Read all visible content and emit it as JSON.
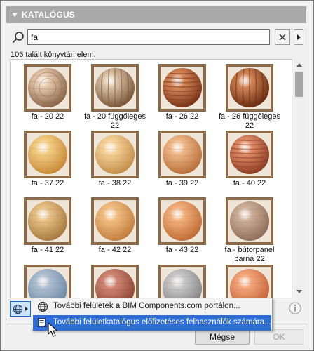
{
  "catalog": {
    "header": "KATALÓGUS",
    "search_value": "fa",
    "result_count": "106 talált könyvtári elem:"
  },
  "items": [
    {
      "label": "fa - 20 22",
      "colors": [
        "#e6c9ad",
        "#8a6448"
      ],
      "style": "ring"
    },
    {
      "label": "fa - 20 függőleges 22",
      "colors": [
        "#dcc4a8",
        "#7a5638"
      ],
      "style": "vertical"
    },
    {
      "label": "fa - 26 22",
      "colors": [
        "#d78a5a",
        "#7a3318"
      ],
      "style": "bands"
    },
    {
      "label": "fa - 26 függőleges 22",
      "colors": [
        "#d08554",
        "#6a2c12"
      ],
      "style": "vertical"
    },
    {
      "label": "fa - 37 22",
      "colors": [
        "#f4cf86",
        "#c98a38"
      ],
      "style": "plain"
    },
    {
      "label": "fa - 38 22",
      "colors": [
        "#f6d299",
        "#c48e4a"
      ],
      "style": "plain"
    },
    {
      "label": "fa - 39 22",
      "colors": [
        "#f0b98a",
        "#b8703a"
      ],
      "style": "plain"
    },
    {
      "label": "fa - 40 22",
      "colors": [
        "#e2906a",
        "#8e3f24"
      ],
      "style": "bands"
    },
    {
      "label": "fa - 41 22",
      "colors": [
        "#e8c287",
        "#a67a3e"
      ],
      "style": "plain"
    },
    {
      "label": "fa - 42 22",
      "colors": [
        "#f2be82",
        "#c27e3e"
      ],
      "style": "plain"
    },
    {
      "label": "fa - 43 22",
      "colors": [
        "#f2b07c",
        "#bf6d34"
      ],
      "style": "plain"
    },
    {
      "label": "fa - bútorpanel barna 22",
      "colors": [
        "#cdb09a",
        "#8f6e58"
      ],
      "style": "plain"
    },
    {
      "label": "",
      "colors": [
        "#aebfd0",
        "#6e8aa5"
      ],
      "style": "plain"
    },
    {
      "label": "",
      "colors": [
        "#d08573",
        "#8d4635"
      ],
      "style": "plain"
    },
    {
      "label": "",
      "colors": [
        "#c8c8c8",
        "#858585"
      ],
      "style": "plain"
    },
    {
      "label": "",
      "colors": [
        "#f3a57a",
        "#c5643a"
      ],
      "style": "plain"
    }
  ],
  "menu": {
    "item1": "További felületek a BIM Components.com portálon...",
    "item2": "További felületkatalógus előfizetéses felhasználók számára..."
  },
  "buttons": {
    "cancel": "Mégse",
    "ok": "OK"
  },
  "icons": [
    "search-icon",
    "clear-icon",
    "expand-arrow-icon",
    "globe-icon",
    "info-icon",
    "catalog-download-icon",
    "mouse-cursor-icon"
  ],
  "colors": {
    "header_bg": "#a9a9a9",
    "menu_highlight": "#2d6fd6",
    "web_button_bg": "#cfe3fa"
  }
}
